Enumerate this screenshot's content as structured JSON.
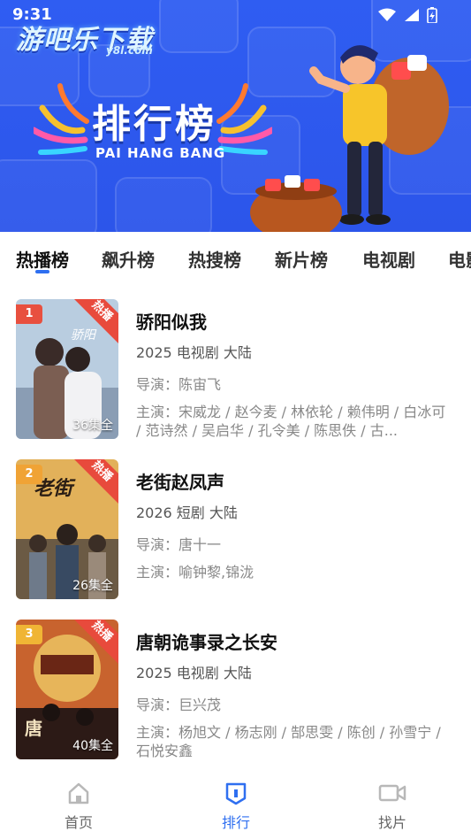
{
  "status_bar": {
    "time": "9:31"
  },
  "banner": {
    "logo_text": "游吧乐下载",
    "logo_sub": "y8l.com",
    "title": "排行榜",
    "subtitle": "PAI HANG BANG"
  },
  "tabs": [
    {
      "label": "热播榜",
      "active": true
    },
    {
      "label": "飙升榜",
      "active": false
    },
    {
      "label": "热搜榜",
      "active": false
    },
    {
      "label": "新片榜",
      "active": false
    },
    {
      "label": "电视剧",
      "active": false
    },
    {
      "label": "电影",
      "active": false
    }
  ],
  "hot_label": "热播",
  "items": [
    {
      "rank": "1",
      "rank_color": "#e8503f",
      "title": "骄阳似我",
      "meta": "2025  电视剧  大陆",
      "director": "导演：陈宙飞",
      "cast": "主演：宋威龙 / 赵今麦 / 林依轮 / 赖伟明 / 白冰可 / 范诗然 / 吴启华 / 孔令美 / 陈思佚 / 古...",
      "episodes": "36集全"
    },
    {
      "rank": "2",
      "rank_color": "#f0a335",
      "title": "老街赵凤声",
      "meta": "2026  短剧  大陆",
      "director": "导演：唐十一",
      "cast": "主演：喻钟黎,锦泷",
      "episodes": "26集全"
    },
    {
      "rank": "3",
      "rank_color": "#f0b535",
      "title": "唐朝诡事录之长安",
      "meta": "2025  电视剧  大陆",
      "director": "导演：巨兴茂",
      "cast": "主演：杨旭文 / 杨志刚 / 郜思雯 / 陈创 / 孙雪宁 / 石悦安鑫",
      "episodes": "40集全"
    }
  ],
  "bottom_nav": [
    {
      "label": "首页",
      "icon": "home-icon",
      "active": false
    },
    {
      "label": "排行",
      "icon": "ranking-icon",
      "active": true
    },
    {
      "label": "找片",
      "icon": "video-camera-icon",
      "active": false
    }
  ],
  "colors": {
    "accent": "#2f6ff0",
    "banner_bg": "#2f5df2",
    "hot": "#e84a3c"
  }
}
